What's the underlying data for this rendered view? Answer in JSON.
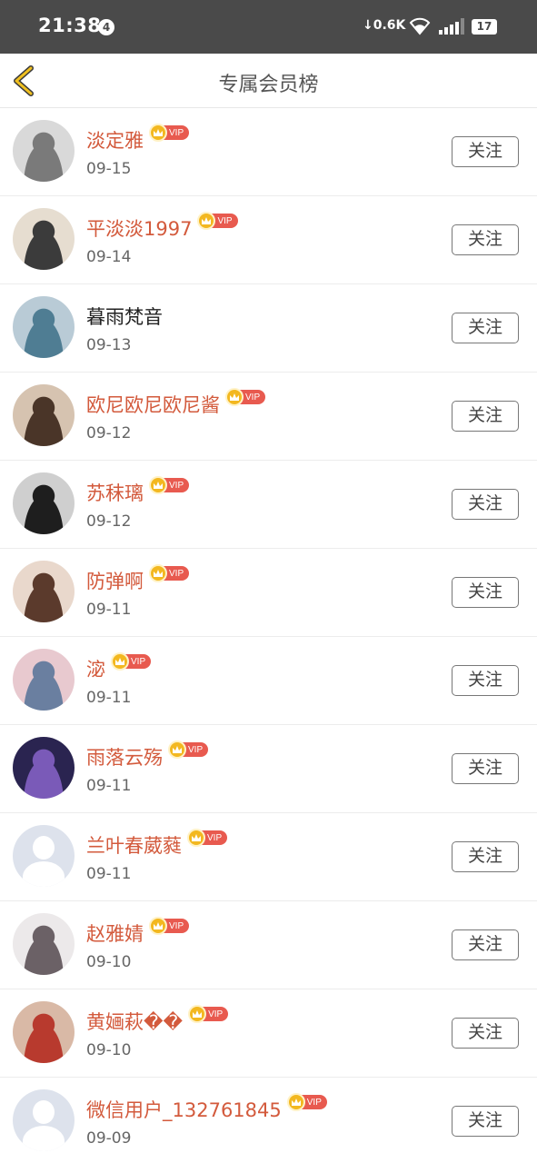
{
  "status_bar": {
    "time": "21:38",
    "notification_count": "4",
    "net_speed": "0.6K",
    "battery": "17"
  },
  "header": {
    "title": "专属会员榜",
    "back_icon": "chevron-left-icon",
    "accent_color": "#f0c020"
  },
  "vip_label": "VIP",
  "colors": {
    "vip_name": "#d35a3c",
    "normal_name": "#222222",
    "vip_badge": "#e85a4f",
    "crown": "#f3b820"
  },
  "members": [
    {
      "name": "淡定雅",
      "date": "09-15",
      "vip": true,
      "follow_label": "关注",
      "avatar": "photo"
    },
    {
      "name": "平淡淡1997",
      "date": "09-14",
      "vip": true,
      "follow_label": "关注",
      "avatar": "photo"
    },
    {
      "name": "暮雨梵音",
      "date": "09-13",
      "vip": false,
      "follow_label": "关注",
      "avatar": "photo"
    },
    {
      "name": "欧尼欧尼欧尼酱",
      "date": "09-12",
      "vip": true,
      "follow_label": "关注",
      "avatar": "photo"
    },
    {
      "name": "苏秣璃",
      "date": "09-12",
      "vip": true,
      "follow_label": "关注",
      "avatar": "photo"
    },
    {
      "name": "防弹啊",
      "date": "09-11",
      "vip": true,
      "follow_label": "关注",
      "avatar": "photo"
    },
    {
      "name": "淧",
      "date": "09-11",
      "vip": true,
      "follow_label": "关注",
      "avatar": "photo"
    },
    {
      "name": "雨落云殇",
      "date": "09-11",
      "vip": true,
      "follow_label": "关注",
      "avatar": "photo"
    },
    {
      "name": "兰叶春葳蕤",
      "date": "09-11",
      "vip": true,
      "follow_label": "关注",
      "avatar": "default"
    },
    {
      "name": "赵雅婧",
      "date": "09-10",
      "vip": true,
      "follow_label": "关注",
      "avatar": "photo"
    },
    {
      "name": "黄婳萩��",
      "date": "09-10",
      "vip": true,
      "follow_label": "关注",
      "avatar": "photo"
    },
    {
      "name": "微信用户_132761845",
      "date": "09-09",
      "vip": true,
      "follow_label": "关注",
      "avatar": "default"
    }
  ]
}
